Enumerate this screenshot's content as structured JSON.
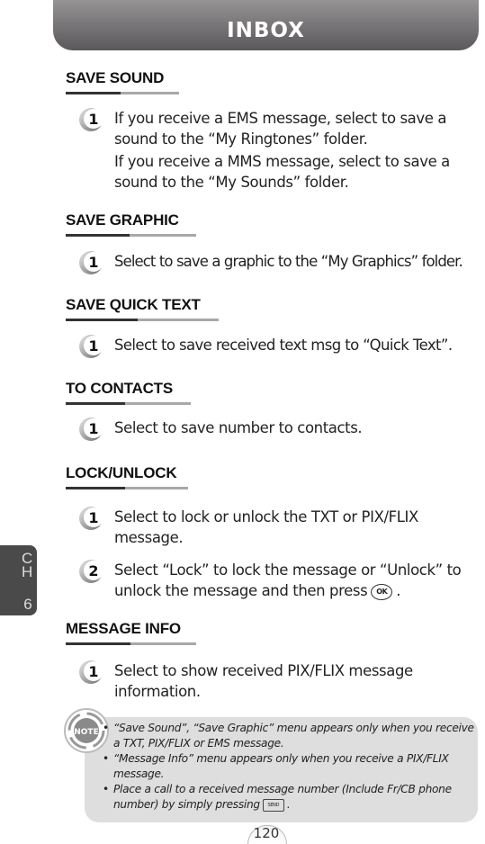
{
  "header": {
    "title": "INBOX"
  },
  "chapter_tab": {
    "label": "CH",
    "number": "6"
  },
  "sections": [
    {
      "heading": "SAVE SOUND",
      "steps": [
        {
          "number": "1",
          "paragraphs": [
            "If you receive a EMS message, select to save a sound to the “My Ringtones” folder.",
            "If you receive a MMS message, select to save a sound to the “My Sounds” folder."
          ]
        }
      ]
    },
    {
      "heading": "SAVE GRAPHIC",
      "steps": [
        {
          "number": "1",
          "paragraphs": [
            "Select to save a graphic to the “My Graphics” folder."
          ]
        }
      ]
    },
    {
      "heading": "SAVE QUICK TEXT",
      "steps": [
        {
          "number": "1",
          "paragraphs": [
            "Select to save received text msg to “Quick Text”."
          ]
        }
      ]
    },
    {
      "heading": "TO CONTACTS",
      "steps": [
        {
          "number": "1",
          "paragraphs": [
            "Select to save number to contacts."
          ]
        }
      ]
    },
    {
      "heading": "LOCK/UNLOCK",
      "steps": [
        {
          "number": "1",
          "paragraphs": [
            "Select to lock or unlock the TXT or PIX/FLIX message."
          ]
        },
        {
          "number": "2",
          "text_before_key": "Select “Lock” to lock the message or “Unlock” to unlock the message and then press",
          "key": "OK",
          "text_after_key": "."
        }
      ]
    },
    {
      "heading": "MESSAGE INFO",
      "steps": [
        {
          "number": "1",
          "paragraphs": [
            "Select to show received PIX/FLIX message information."
          ]
        }
      ]
    }
  ],
  "note": {
    "icon_label": "NOTE",
    "items": [
      "“Save Sound”, “Save Graphic” menu appears only when you receive a TXT, PIX/FLIX or EMS message.",
      "“Message Info” menu appears only when you receive a PIX/FLIX message.",
      {
        "text_before_key": "Place a call to a received message number (Include Fr/CB phone number) by simply pressing",
        "key": "SEND",
        "text_after_key": "."
      }
    ]
  },
  "page_number": "120"
}
